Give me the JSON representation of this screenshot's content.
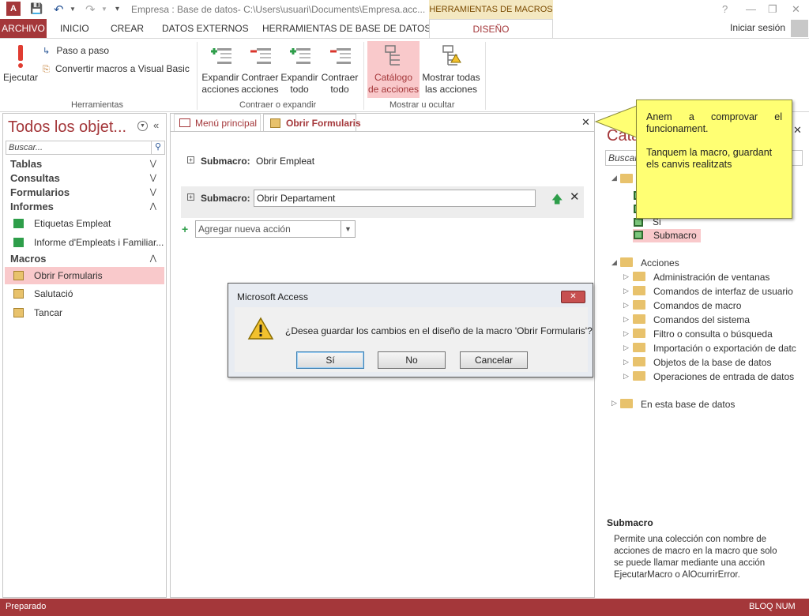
{
  "titlebar": {
    "title": "Empresa : Base de datos- C:\\Users\\usuari\\Documents\\Empresa.acc...",
    "context_tab": "HERRAMIENTAS DE MACROS",
    "help": "?",
    "minimize": "—",
    "restore": "❐",
    "close": "✕"
  },
  "tabs": {
    "archivo": "ARCHIVO",
    "inicio": "INICIO",
    "crear": "CREAR",
    "datos_externos": "DATOS EXTERNOS",
    "herramientas_bd": "HERRAMIENTAS DE BASE DE DATOS",
    "diseno": "DISEÑO",
    "signin": "Iniciar sesión"
  },
  "ribbon": {
    "ejecutar": "Ejecutar",
    "paso_a_paso": "Paso a paso",
    "convertir": "Convertir macros a Visual Basic",
    "group_herramientas": "Herramientas",
    "expandir_acciones_1": "Expandir",
    "expandir_acciones_2": "acciones",
    "contraer_acciones_1": "Contraer",
    "contraer_acciones_2": "acciones",
    "expandir_todo_1": "Expandir",
    "expandir_todo_2": "todo",
    "contraer_todo_1": "Contraer",
    "contraer_todo_2": "todo",
    "group_contraer": "Contraer o expandir",
    "catalogo_1": "Catálogo",
    "catalogo_2": "de acciones",
    "mostrar_1": "Mostrar todas",
    "mostrar_2": "las acciones",
    "group_mostrar": "Mostrar u ocultar"
  },
  "nav": {
    "title": "Todos los objet...",
    "search_placeholder": "Buscar...",
    "categories": {
      "tablas": "Tablas",
      "consultas": "Consultas",
      "formularios": "Formularios",
      "informes": "Informes",
      "macros": "Macros"
    },
    "reports": [
      "Etiquetas Empleat",
      "Informe d'Empleats i Familiar..."
    ],
    "macros": [
      "Obrir Formularis",
      "Salutació",
      "Tancar"
    ]
  },
  "doc": {
    "tabs": [
      "Menú principal",
      "Obrir Formularis"
    ],
    "close": "✕",
    "submacro_label": "Submacro:",
    "submacro1_name": "Obrir Empleat",
    "submacro2_name": "Obrir Departament",
    "add_action": "Agregar nueva acción"
  },
  "catalog": {
    "title": "Cata",
    "search_placeholder": "Buscar",
    "close": "✕",
    "flow_items": [
      "Si",
      "Submacro"
    ],
    "acciones": "Acciones",
    "action_folders": [
      "Administración de ventanas",
      "Comandos de interfaz de usuario",
      "Comandos de macro",
      "Comandos del sistema",
      "Filtro o consulta o búsqueda",
      "Importación o exportación de datc",
      "Objetos de la base de datos",
      "Operaciones de entrada de datos"
    ],
    "en_esta_bd": "En esta base de datos",
    "help_title": "Submacro",
    "help_text": "Permite una colección con nombre de acciones de macro en la macro que solo se puede llamar mediante una acción EjecutarMacro o AlOcurrirError."
  },
  "dialog": {
    "title": "Microsoft Access",
    "message": "¿Desea guardar los cambios en el diseño de la macro 'Obrir Formularis'?",
    "btn_si": "Sí",
    "btn_no": "No",
    "btn_cancelar": "Cancelar"
  },
  "callout": {
    "line1": "Anem a comprovar el funcionament.",
    "line2": "Tanquem la macro, guardant els canvis realitzats"
  },
  "status": {
    "left": "Preparado",
    "right": "BLOQ NUM"
  },
  "colors": {
    "access_red": "#a4373a",
    "context_tab_bg": "#f4e8c1",
    "callout_yellow": "#ffff73",
    "selected_pink": "#f9c9cb"
  }
}
